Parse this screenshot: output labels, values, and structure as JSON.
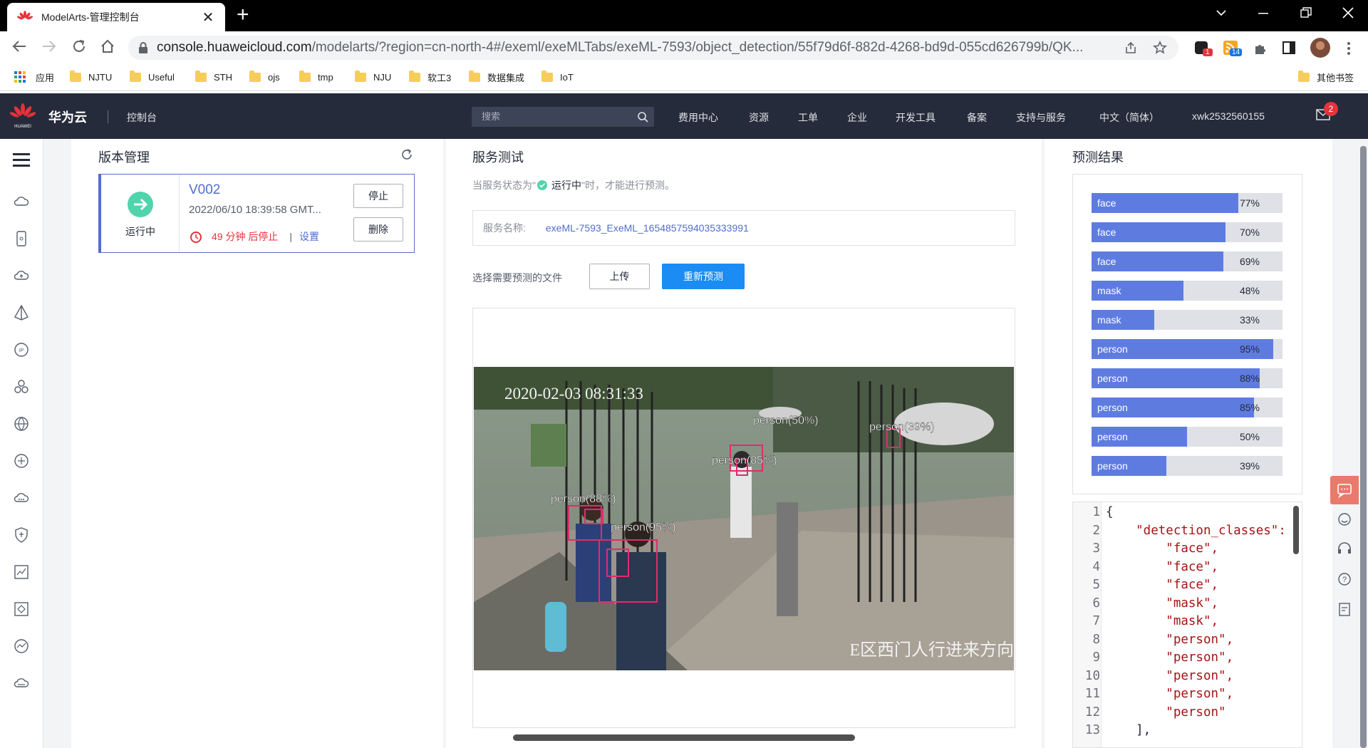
{
  "browser": {
    "tab_title": "ModelArts-管理控制台",
    "close": "✕",
    "newtab": "+",
    "url_host": "console.huaweicloud.com",
    "url_path": "/modelarts/?region=cn-north-4#/exeml/exeMLTabs/exeML-7593/object_detection/55f79d6f-882d-4268-bd9d-055cd626799b/QK...",
    "ext_badge_1": "1",
    "ext_badge_14": "14",
    "bookmarks": [
      "应用",
      "NJTU",
      "Useful",
      "STH",
      "ojs",
      "tmp",
      "NJU",
      "软工3",
      "数据集成",
      "IoT"
    ],
    "other_bookmarks": "其他书签"
  },
  "header": {
    "logo_text": "HUAWEI",
    "brand": "华为云",
    "console": "控制台",
    "search_placeholder": "搜索",
    "nav": [
      "费用中心",
      "资源",
      "工单",
      "企业",
      "开发工具",
      "备案",
      "支持与服务",
      "中文（简体）",
      "xwk2532560155"
    ],
    "mail_count": "2"
  },
  "version_panel": {
    "title": "版本管理",
    "version": "V002",
    "status": "运行中",
    "date": "2022/06/10 18:39:58 GMT...",
    "timer": "49 分钟 后停止",
    "separator": "|",
    "settings": "设置",
    "stop_button": "停止",
    "delete_button": "删除"
  },
  "service_panel": {
    "title": "服务测试",
    "hint_prefix": "当服务状态为\"",
    "hint_status": "运行中",
    "hint_suffix": "\"时，才能进行预测。",
    "service_name_label": "服务名称:",
    "service_name": "exeML-7593_ExeML_1654857594035333991",
    "file_label": "选择需要预测的文件",
    "upload_button": "上传",
    "repredict_button": "重新预测",
    "photo_timestamp": "2020-02-03  08:31:33",
    "photo_caption": "E区西门人行进来方向",
    "boxes": [
      {
        "label": "person(50%)"
      },
      {
        "label": "person(39%)"
      },
      {
        "label": "person(85%)"
      },
      {
        "label": "person(88%)"
      },
      {
        "label": "person(95%)"
      }
    ]
  },
  "result_panel": {
    "title": "预测结果",
    "results": [
      {
        "label": "face",
        "pct": "77%",
        "value": 0.77
      },
      {
        "label": "face",
        "pct": "70%",
        "value": 0.7
      },
      {
        "label": "face",
        "pct": "69%",
        "value": 0.69
      },
      {
        "label": "mask",
        "pct": "48%",
        "value": 0.48
      },
      {
        "label": "mask",
        "pct": "33%",
        "value": 0.33
      },
      {
        "label": "person",
        "pct": "95%",
        "value": 0.95
      },
      {
        "label": "person",
        "pct": "88%",
        "value": 0.88
      },
      {
        "label": "person",
        "pct": "85%",
        "value": 0.85
      },
      {
        "label": "person",
        "pct": "50%",
        "value": 0.5
      },
      {
        "label": "person",
        "pct": "39%",
        "value": 0.39
      }
    ],
    "code_lines": [
      {
        "n": "1",
        "t": "{"
      },
      {
        "n": "2",
        "t": "    \"detection_classes\":"
      },
      {
        "n": "3",
        "t": "        \"face\","
      },
      {
        "n": "4",
        "t": "        \"face\","
      },
      {
        "n": "5",
        "t": "        \"face\","
      },
      {
        "n": "6",
        "t": "        \"mask\","
      },
      {
        "n": "7",
        "t": "        \"mask\","
      },
      {
        "n": "8",
        "t": "        \"person\","
      },
      {
        "n": "9",
        "t": "        \"person\","
      },
      {
        "n": "10",
        "t": "        \"person\","
      },
      {
        "n": "11",
        "t": "        \"person\","
      },
      {
        "n": "12",
        "t": "        \"person\""
      },
      {
        "n": "13",
        "t": "    ],"
      }
    ]
  },
  "colors": {
    "header_bg": "#252b3a",
    "accent": "#526ecc",
    "bar": "#5e7ce0",
    "primary_button": "#1a8cf4",
    "danger": "#e5323c",
    "running": "#50d4ab"
  }
}
